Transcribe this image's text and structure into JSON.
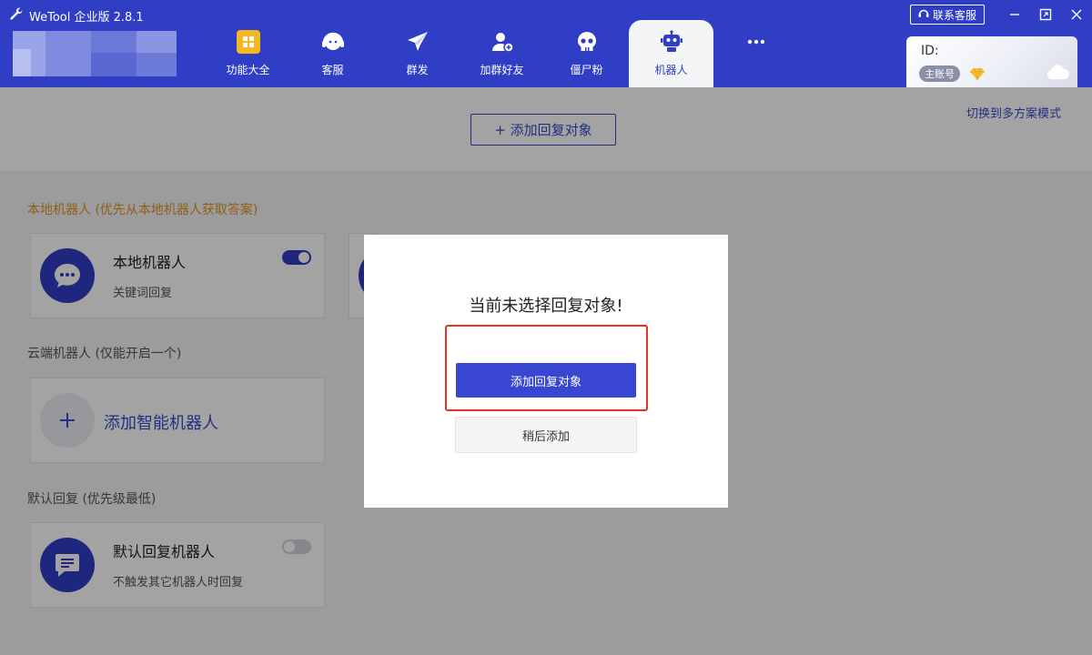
{
  "app": {
    "title": "WeTool 企业版 2.8.1"
  },
  "window": {
    "contact_label": "联系客服"
  },
  "nav": {
    "items": [
      {
        "label": "功能大全",
        "icon": "grid-icon"
      },
      {
        "label": "客服",
        "icon": "headset-icon"
      },
      {
        "label": "群发",
        "icon": "paper-plane-icon"
      },
      {
        "label": "加群好友",
        "icon": "add-friend-icon"
      },
      {
        "label": "僵尸粉",
        "icon": "skull-icon"
      },
      {
        "label": "机器人",
        "icon": "robot-icon",
        "active": true
      }
    ],
    "more_icon": "more-icon"
  },
  "account": {
    "id_label": "ID:",
    "badge": "主账号"
  },
  "content": {
    "add_target_button": "+ 添加回复对象",
    "switch_link": "切换到多方案模式",
    "local_section_title": "本地机器人 (优先从本地机器人获取答案)",
    "local_robot": {
      "title": "本地机器人",
      "subtitle": "关键词回复",
      "enabled": true
    },
    "cloud_section_title": "云端机器人 (仅能开启一个)",
    "add_smart_robot": "添加智能机器人",
    "default_section_title": "默认回复 (优先级最低)",
    "default_robot": {
      "title": "默认回复机器人",
      "subtitle": "不触发其它机器人时回复",
      "enabled": false
    }
  },
  "modal": {
    "title": "当前未选择回复对象!",
    "primary_button": "添加回复对象",
    "secondary_button": "稍后添加"
  },
  "colors": {
    "brand": "#2f3ec4",
    "accent_orange": "#e1951e",
    "highlight_red": "#e5332a"
  }
}
